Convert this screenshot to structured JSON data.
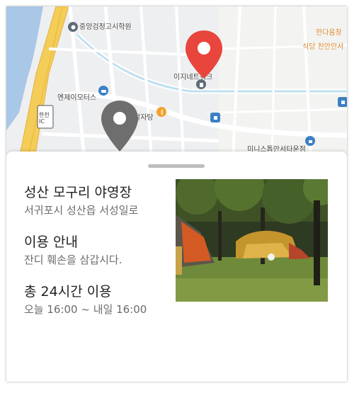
{
  "map": {
    "labels": {
      "school": "중앙검정고시학원",
      "network": "이지네트워크",
      "motors": "엔제이모터스",
      "junction": "한천IC",
      "restaurant": "감자탕",
      "store": "미니스톱안서타운점",
      "top_right_1": "한다움창",
      "top_right_2": "식당 천안안서"
    },
    "selected_pin_color": "#e8453c",
    "other_pin_color": "#6e6e6e"
  },
  "place": {
    "name": "성산 모구리 야영장",
    "address": "서귀포시 성산읍 서성일로"
  },
  "usage": {
    "title": "이용 안내",
    "notice": "잔디 훼손을 삼갑시다."
  },
  "hours": {
    "title": "총 24시간 이용",
    "range": "오늘 16:00 ~ 내일 16:00"
  }
}
